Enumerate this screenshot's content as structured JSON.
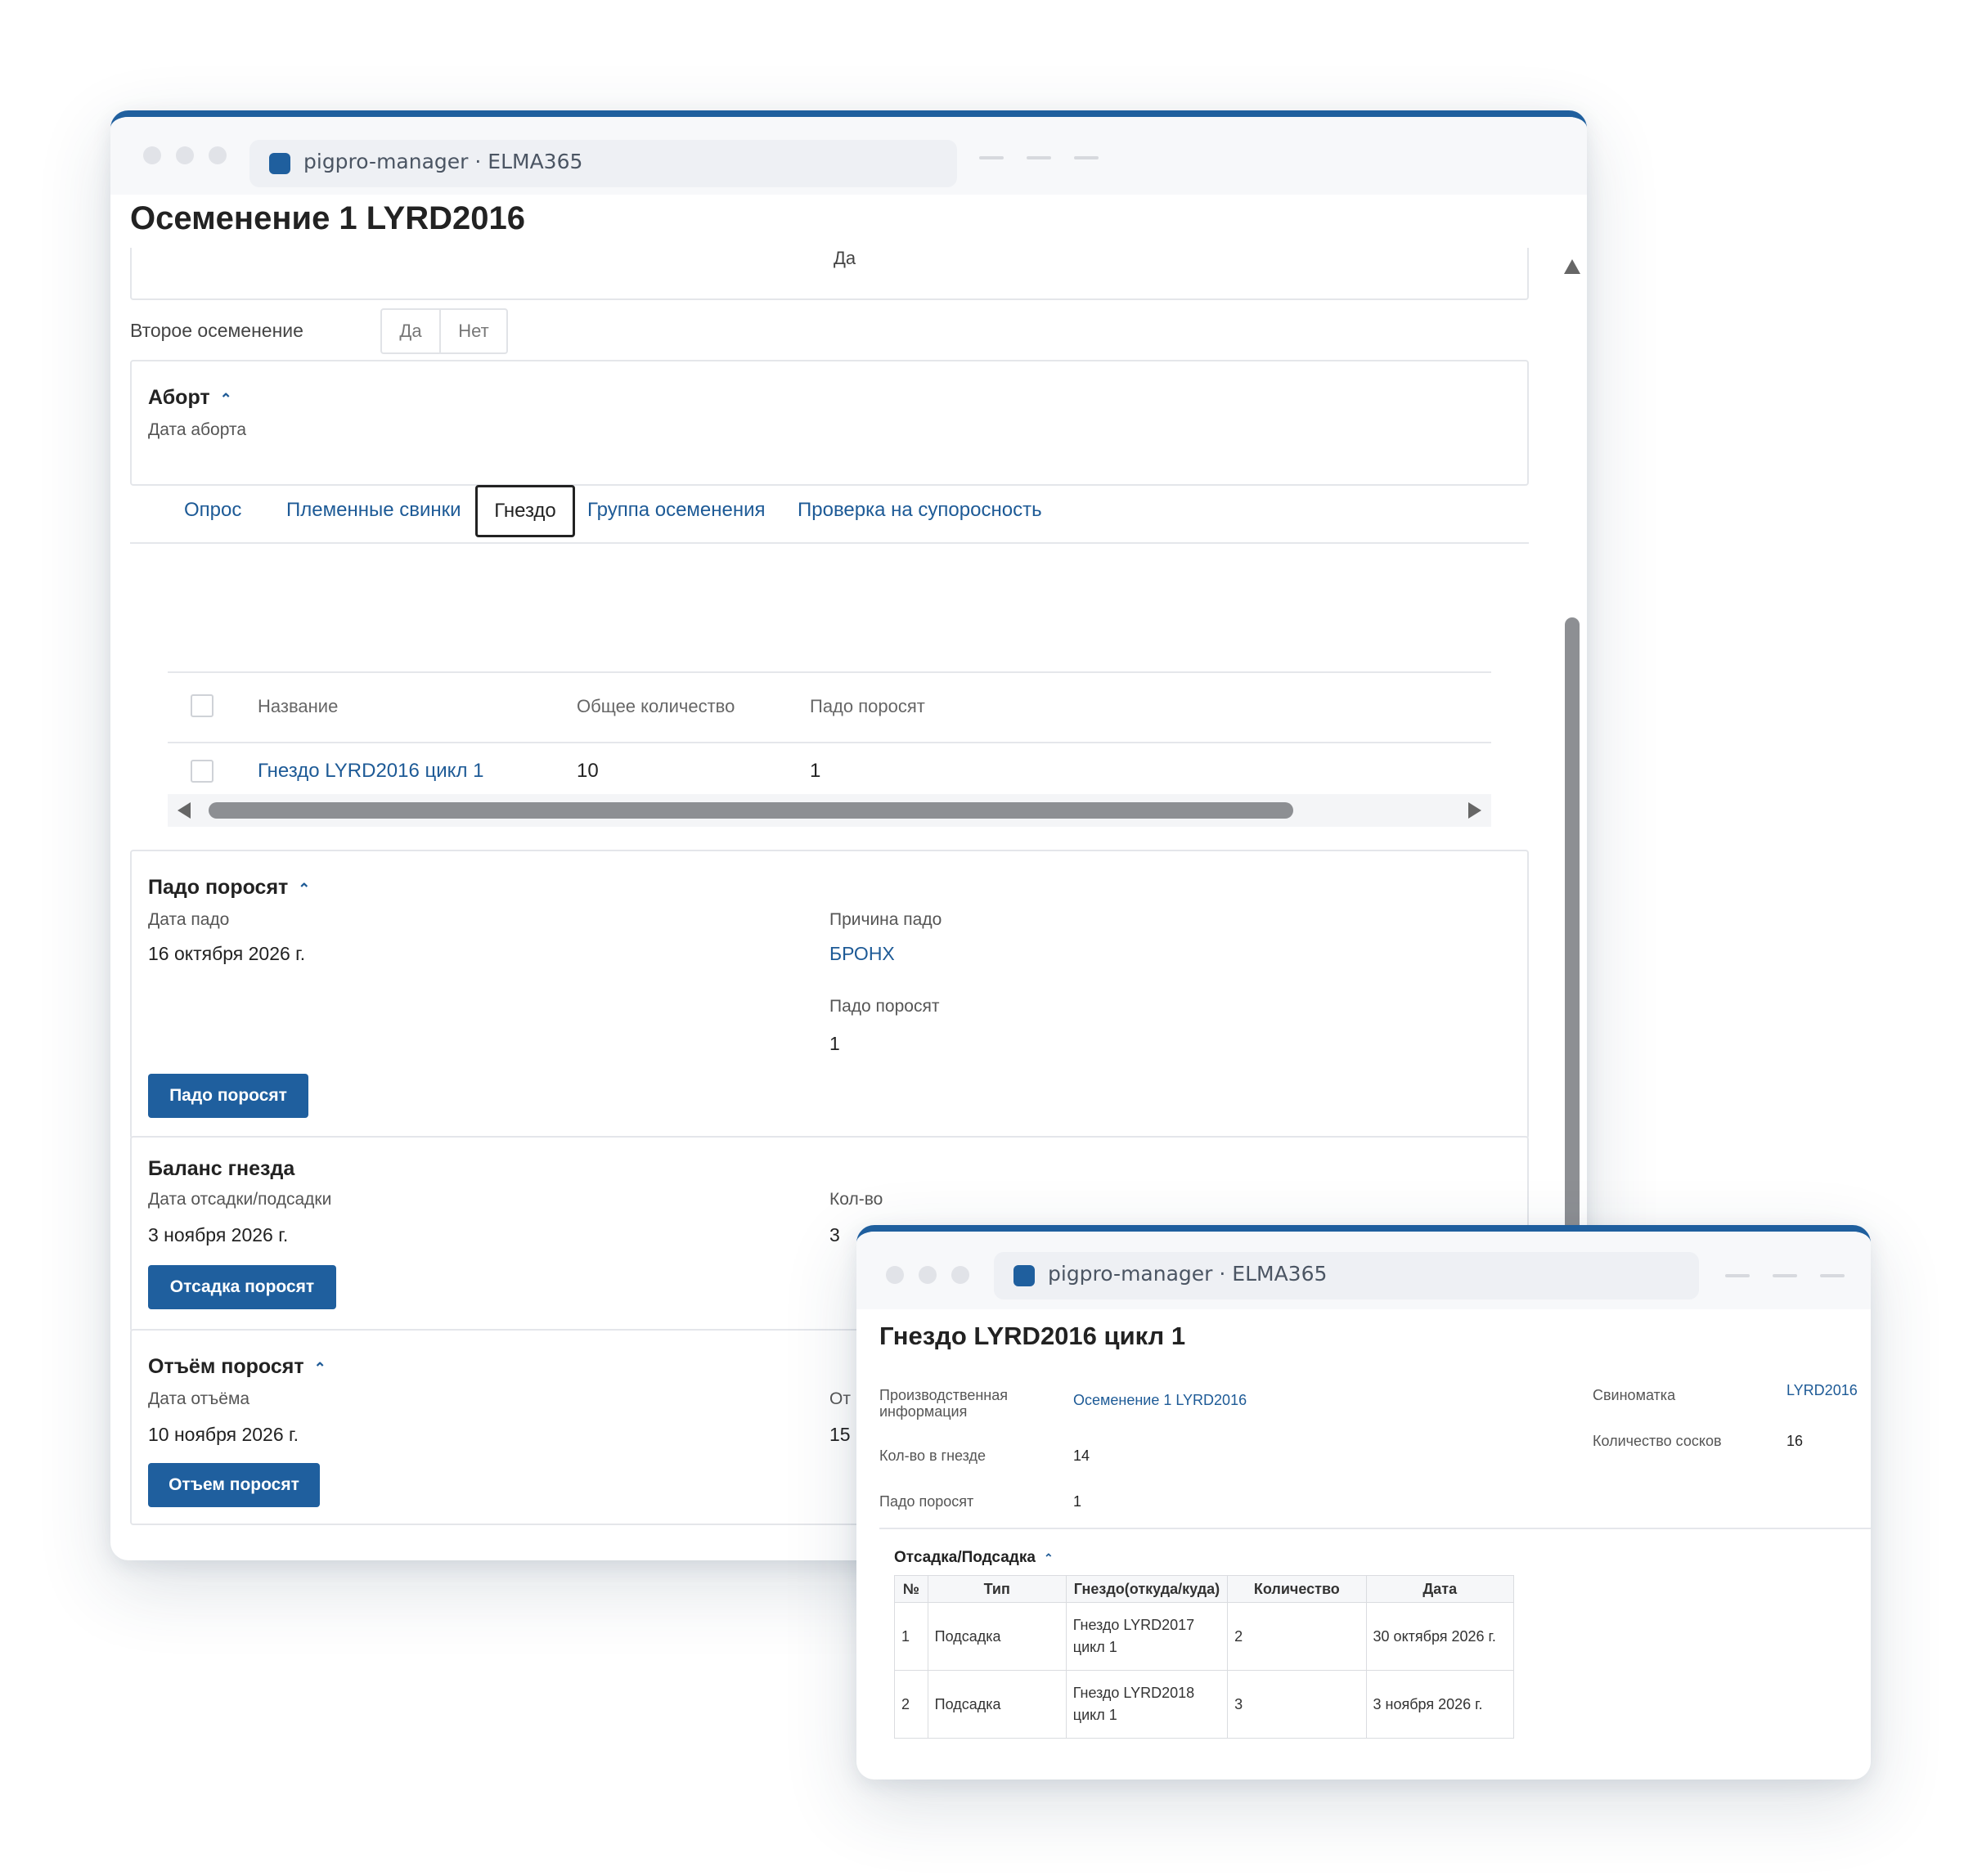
{
  "main_window": {
    "url": "pigpro-manager · ELMA365",
    "page_title": "Осеменение 1 LYRD2016",
    "top_value": "Да",
    "second_insemination": {
      "label": "Второе осеменение",
      "yes": "Да",
      "no": "Нет"
    },
    "abort": {
      "title": "Аборт",
      "date_label": "Дата аборта"
    },
    "tabs": [
      "Опрос",
      "Племенные свинки",
      "Гнездо",
      "Группа осеменения",
      "Проверка на супоросность"
    ],
    "table": {
      "columns": [
        "Название",
        "Общее количество",
        "Падо поросят"
      ],
      "rows": [
        {
          "name": "Гнездо LYRD2016 цикл 1",
          "total": "10",
          "fall": "1"
        }
      ]
    },
    "piglet_loss": {
      "title": "Падо поросят",
      "date_label": "Дата падо",
      "date_value": "16 октября 2026 г.",
      "reason_label": "Причина падо",
      "reason_value": "БРОНХ",
      "count_label": "Падо поросят",
      "count_value": "1",
      "button": "Падо поросят"
    },
    "nest_balance": {
      "title": "Баланс гнезда",
      "date_label": "Дата отсадки/подсадки",
      "date_value": "3 ноября 2026 г.",
      "qty_label": "Кол-во",
      "qty_value": "3",
      "button": "Отсадка поросят"
    },
    "weaning": {
      "title": "Отъём поросят",
      "date_label": "Дата отъёма",
      "date_value": "10 ноября 2026 г.",
      "partial_label": "От",
      "partial_value": "15",
      "button": "Отъем поросят"
    }
  },
  "popup_window": {
    "url": "pigpro-manager · ELMA365",
    "page_title": "Гнездо LYRD2016 цикл 1",
    "prod_info_label_1": "Производственная",
    "prod_info_label_2": "информация",
    "prod_info_value": "Осеменение 1 LYRD2016",
    "count_in_nest_label": "Кол-во в гнезде",
    "count_in_nest_value": "14",
    "fall_label": "Падо поросят",
    "fall_value": "1",
    "sow_label": "Свиноматка",
    "sow_value": "LYRD2016",
    "teats_label": "Количество сосков",
    "teats_value": "16",
    "transfer": {
      "title": "Отсадка/Подсадка",
      "columns": [
        "№",
        "Тип",
        "Гнездо(откуда/куда)",
        "Количество",
        "Дата"
      ],
      "rows": [
        {
          "n": "1",
          "type": "Подсадка",
          "nest_1": "Гнездо LYRD2017",
          "nest_2": "цикл 1",
          "qty": "2",
          "date": "30 октября 2026 г."
        },
        {
          "n": "2",
          "type": "Подсадка",
          "nest_1": "Гнездо LYRD2018",
          "nest_2": "цикл 1",
          "qty": "3",
          "date": "3 ноября 2026 г."
        }
      ]
    }
  },
  "colors": {
    "accent": "#1f5f9e",
    "link": "#1d5a96",
    "border": "#e4e6ea"
  },
  "icons": [
    "chevron-up-icon",
    "scroll-left-arrow-icon",
    "scroll-right-arrow-icon",
    "scroll-up-arrow-icon",
    "app-favicon-icon"
  ]
}
